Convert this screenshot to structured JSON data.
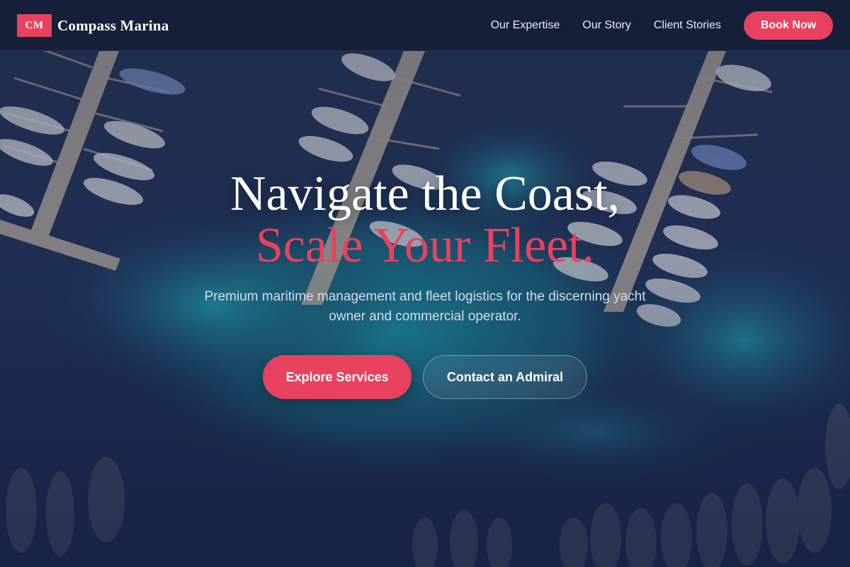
{
  "brand": {
    "badge": "CM",
    "name": "Compass Marina"
  },
  "nav": {
    "links": [
      "Our Expertise",
      "Our Story",
      "Client Stories"
    ],
    "cta": "Book Now"
  },
  "hero": {
    "headline_line1": "Navigate the Coast,",
    "headline_line2": "Scale Your Fleet.",
    "subtitle": "Premium maritime management and fleet logistics for the discerning yacht owner and commercial operator.",
    "primary_button": "Explore Services",
    "secondary_button": "Contact an Admiral"
  },
  "colors": {
    "accent": "#e8425e",
    "navbar": "#161f3a",
    "water_deep": "#1d2b52",
    "water_teal": "#1f8a9a"
  },
  "background_image": "aerial-marina-photo"
}
